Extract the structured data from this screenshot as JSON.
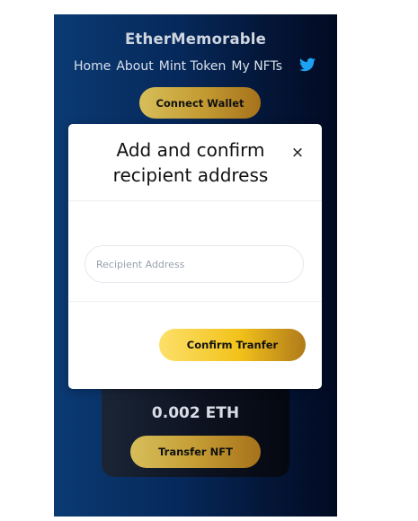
{
  "header": {
    "brand": "EtherMemorable",
    "nav": [
      "Home",
      "About",
      "Mint Token",
      "My NFTs"
    ],
    "social_icon": "twitter-icon",
    "connect_label": "Connect Wallet"
  },
  "card": {
    "price": "0.002 ETH",
    "transfer_label": "Transfer NFT"
  },
  "modal": {
    "title": "Add and confirm recipient address",
    "close_label": "×",
    "input": {
      "placeholder": "Recipient Address",
      "value": ""
    },
    "confirm_label": "Confirm Tranfer"
  },
  "colors": {
    "background_start": "#0b3a73",
    "background_end": "#020a22",
    "gold_light": "#fde06a",
    "gold_dark": "#a6721b",
    "twitter_blue": "#1da1f2"
  }
}
